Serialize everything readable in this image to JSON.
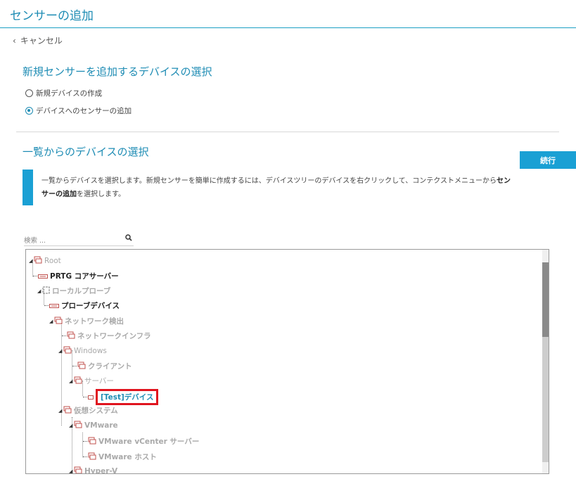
{
  "header": {
    "title": "センサーの追加"
  },
  "cancel": {
    "label": "キャンセル"
  },
  "section1": {
    "title": "新規センサーを追加するデバイスの選択",
    "options": [
      {
        "label": "新規デバイスの作成",
        "checked": false
      },
      {
        "label": "デバイスへのセンサーの追加",
        "checked": true
      }
    ]
  },
  "section2": {
    "title": "一覧からのデバイスの選択",
    "continue_label": "続行",
    "info": {
      "line1_a": "一覧からデバイスを選択します。新規センサーを簡単に作成するには、デバイスツリーのデバイスを右クリックして、コンテクストメニューから",
      "line1_bold": "セン",
      "line2_bold": "サーの追加",
      "line2_b": "を選択します。"
    }
  },
  "search": {
    "placeholder": "検索 ..."
  },
  "tree": {
    "nodes": [
      {
        "label": "Root",
        "icon": "group-icon"
      },
      {
        "label": "PRTG コアサーバー",
        "icon": "device-icon"
      },
      {
        "label": "ローカルプローブ",
        "icon": "probe-icon"
      },
      {
        "label": "プローブデバイス",
        "icon": "device-icon"
      },
      {
        "label": "ネットワーク検出",
        "icon": "group-icon"
      },
      {
        "label": "ネットワークインフラ",
        "icon": "group-icon"
      },
      {
        "label": "Windows",
        "icon": "group-icon"
      },
      {
        "label": "クライアント",
        "icon": "group-icon"
      },
      {
        "label": "サーバー",
        "icon": "group-icon"
      },
      {
        "label": "[Test]デバイス",
        "icon": "device-icon",
        "selected": true
      },
      {
        "label": "仮想システム",
        "icon": "group-icon"
      },
      {
        "label": "VMware",
        "icon": "group-icon"
      },
      {
        "label": "VMware vCenter サーバー",
        "icon": "group-icon"
      },
      {
        "label": "VMware ホスト",
        "icon": "group-icon"
      },
      {
        "label": "Hyper-V",
        "icon": "group-icon"
      }
    ]
  },
  "colors": {
    "accent": "#1aa0d4",
    "title": "#1e8cb4",
    "highlight": "#e0141e"
  }
}
